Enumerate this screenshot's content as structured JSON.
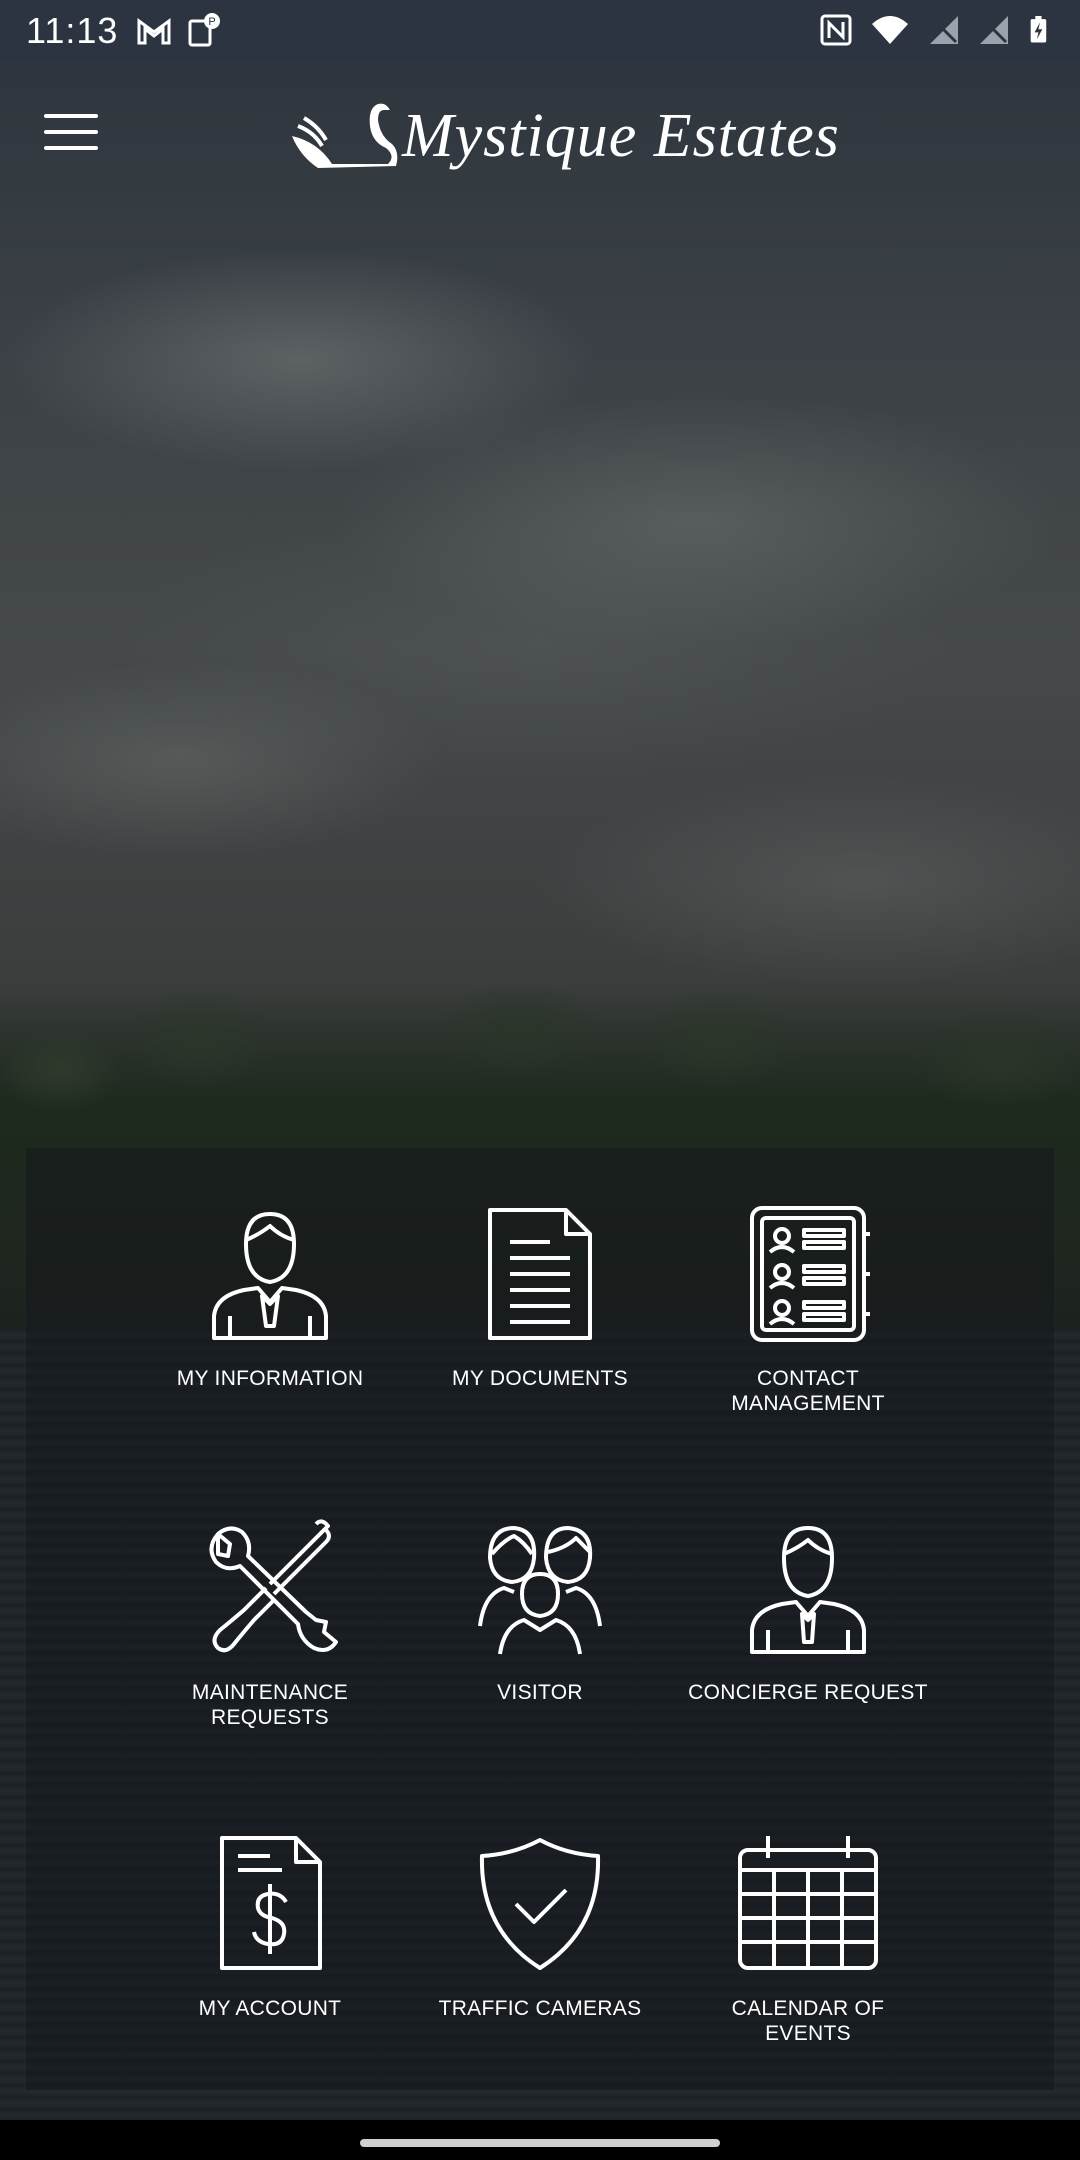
{
  "status_bar": {
    "time": "11:13",
    "left_icons": [
      "gmail-icon",
      "parking-icon"
    ],
    "right_icons": [
      "nfc-icon",
      "wifi-icon",
      "no-signal-icon",
      "no-signal-icon",
      "battery-charging-icon"
    ]
  },
  "header": {
    "menu_icon": "hamburger-menu-icon",
    "logo_text": "Mystique Estates",
    "logo_icon": "swan-icon"
  },
  "menu": {
    "items": [
      {
        "label": "MY INFORMATION",
        "icon": "person-icon"
      },
      {
        "label": "MY DOCUMENTS",
        "icon": "document-icon"
      },
      {
        "label": "CONTACT MANAGEMENT",
        "icon": "contacts-book-icon"
      },
      {
        "label": "MAINTENANCE REQUESTS",
        "icon": "tools-icon"
      },
      {
        "label": "VISITOR",
        "icon": "visitors-group-icon"
      },
      {
        "label": "CONCIERGE REQUEST",
        "icon": "concierge-person-icon"
      },
      {
        "label": "MY ACCOUNT",
        "icon": "invoice-dollar-icon"
      },
      {
        "label": "TRAFFIC CAMERAS",
        "icon": "shield-check-icon"
      },
      {
        "label": "CALENDAR OF EVENTS",
        "icon": "calendar-icon"
      }
    ]
  },
  "colors": {
    "status_bar_bg": "#2b3440",
    "panel_bg": "rgba(20,24,28,0.55)",
    "icon_stroke": "#ffffff"
  }
}
